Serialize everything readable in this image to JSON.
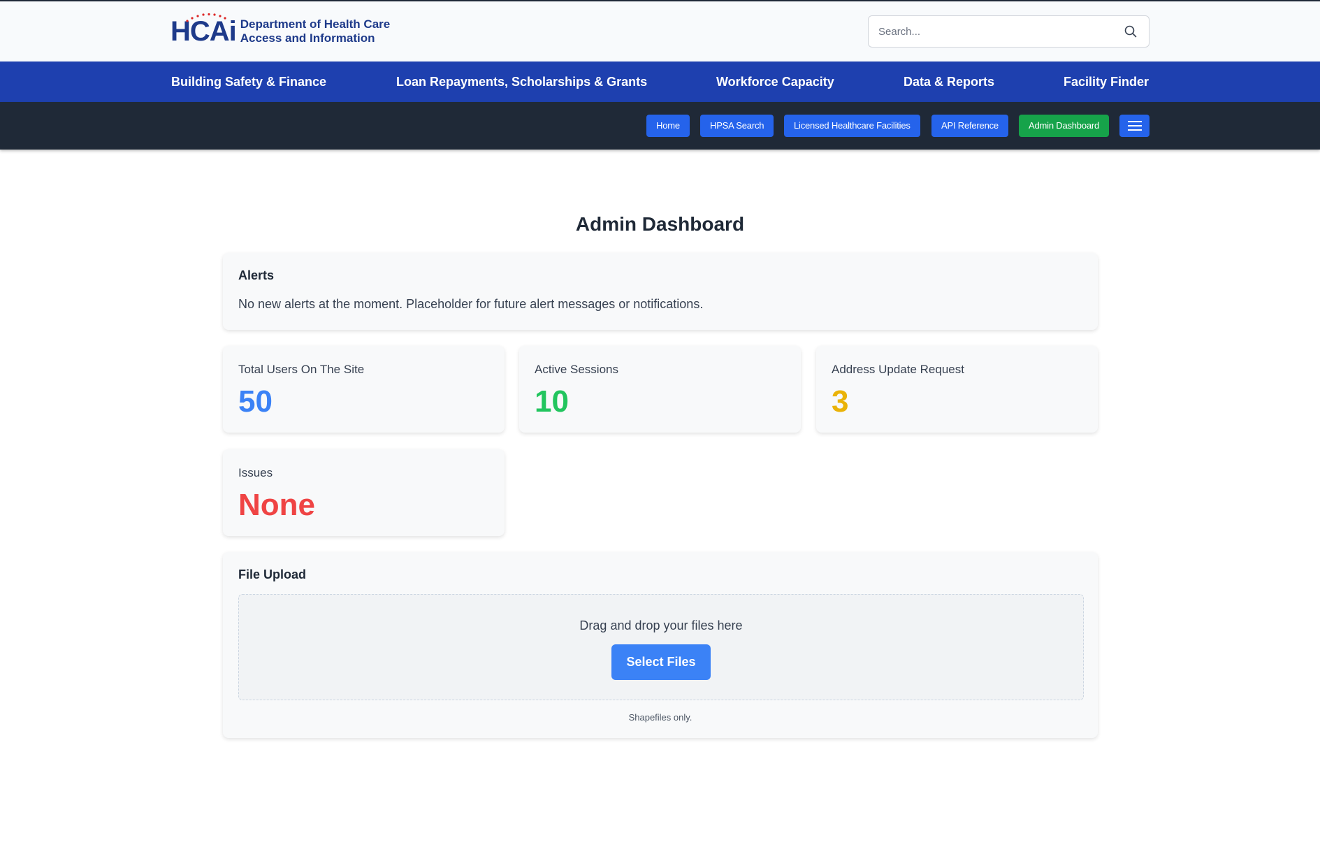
{
  "header": {
    "logo": {
      "mark": "HCAi",
      "line1": "Department of Health Care",
      "line2": "Access and Information"
    },
    "search": {
      "placeholder": "Search...",
      "icon": "search-icon"
    }
  },
  "main_nav": {
    "items": [
      {
        "label": "Building Safety & Finance"
      },
      {
        "label": "Loan Repayments, Scholarships & Grants"
      },
      {
        "label": "Workforce Capacity"
      },
      {
        "label": "Data & Reports"
      },
      {
        "label": "Facility Finder"
      }
    ]
  },
  "sub_nav": {
    "items": [
      {
        "label": "Home"
      },
      {
        "label": "HPSA Search"
      },
      {
        "label": "Licensed Healthcare Facilities"
      },
      {
        "label": "API Reference"
      },
      {
        "label": "Admin Dashboard",
        "active": true
      }
    ],
    "menu_icon": "hamburger-menu-icon"
  },
  "page": {
    "title": "Admin Dashboard"
  },
  "alerts": {
    "title": "Alerts",
    "message": "No new alerts at the moment. Placeholder for future alert messages or notifications."
  },
  "stats": [
    {
      "label": "Total Users On The Site",
      "value": "50",
      "color": "#3b82f6"
    },
    {
      "label": "Active Sessions",
      "value": "10",
      "color": "#22c55e"
    },
    {
      "label": "Address Update Request",
      "value": "3",
      "color": "#eab308"
    },
    {
      "label": "Issues",
      "value": "None",
      "color": "#ef4444"
    }
  ],
  "file_upload": {
    "title": "File Upload",
    "drop_text": "Drag and drop your files here",
    "button_label": "Select Files",
    "note": "Shapefiles only."
  },
  "colors": {
    "brand_blue": "#1e40af",
    "dark_bar": "#1f2937",
    "pill_blue": "#2563eb",
    "pill_active": "#16a34a",
    "logo_red": "#dc2626"
  }
}
